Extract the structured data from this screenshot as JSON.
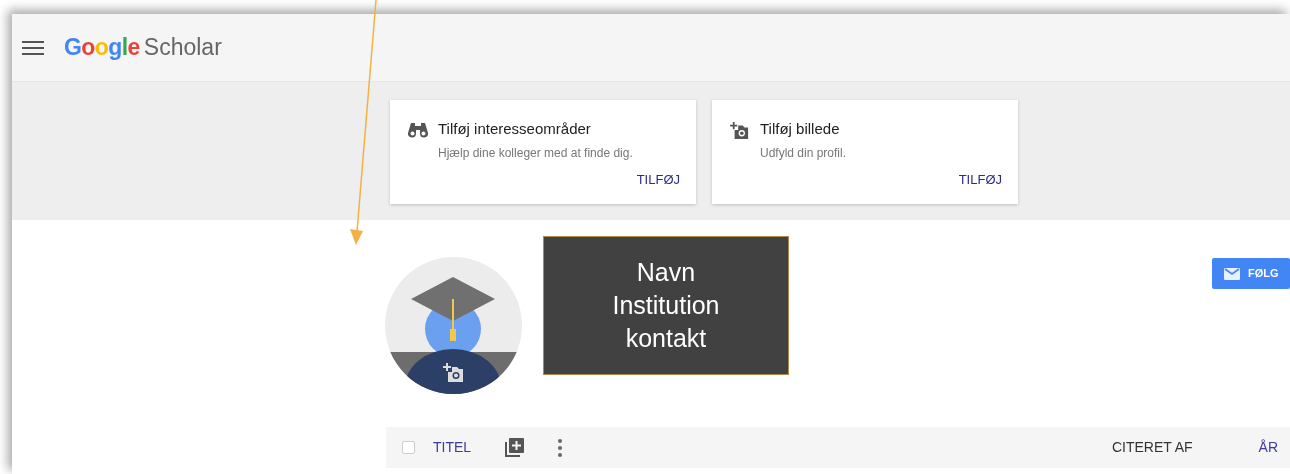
{
  "header": {
    "logo": {
      "brand": "Google",
      "product": "Scholar"
    }
  },
  "cards": [
    {
      "kind": "interests",
      "title": "Tilføj interesseområder",
      "subtitle": "Hjælp dine kolleger med at finde dig.",
      "action": "TILFØJ"
    },
    {
      "kind": "photo",
      "title": "Tilføj billede",
      "subtitle": "Udfyld din profil.",
      "action": "TILFØJ"
    }
  ],
  "profile": {
    "annotation": {
      "lines": [
        "Navn",
        "Institution",
        "kontakt"
      ]
    },
    "follow_button": "FØLG"
  },
  "table_header": {
    "select_all": {
      "checked": false
    },
    "title_column": "TITEL",
    "cited_by_column": "CITERET AF",
    "year_column": "ÅR"
  }
}
